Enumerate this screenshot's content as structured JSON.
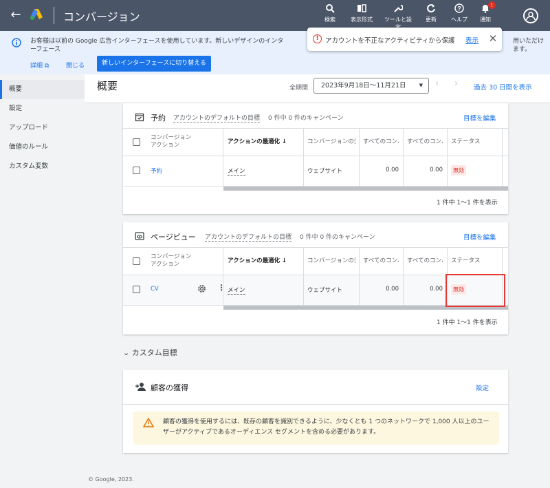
{
  "topbar": {
    "title": "コンバージョン",
    "buttons": [
      {
        "label": "検索",
        "icon": "search-icon"
      },
      {
        "label": "表示形式",
        "icon": "columns-icon"
      },
      {
        "label": "ツールと設定",
        "icon": "wrench-icon"
      },
      {
        "label": "更新",
        "icon": "refresh-icon"
      },
      {
        "label": "ヘルプ",
        "icon": "help-icon"
      },
      {
        "label": "通知",
        "icon": "bell-icon"
      }
    ],
    "notification_badge": "!"
  },
  "banner": {
    "message": "お客様は以前の Google 広告インターフェースを使用しています。新しいデザインのインターフェース",
    "message_tail": "用いただけます。",
    "details_link": "詳細",
    "close_link": "閉じる",
    "switch_button": "新しいインターフェースに切り替える"
  },
  "toast": {
    "text": "アカウントを不正なアクティビティから保護",
    "action": "表示"
  },
  "sidebar": {
    "items": [
      {
        "label": "概要",
        "active": true
      },
      {
        "label": "設定"
      },
      {
        "label": "アップロード"
      },
      {
        "label": "価値のルール"
      },
      {
        "label": "カスタム変数"
      }
    ]
  },
  "header": {
    "title": "概要",
    "period_label": "全期間",
    "date_range": "2023年9月18日〜11月21日",
    "quick_range": "過去 30 日間を表示"
  },
  "table_headers": {
    "action": "コンバージョン\nアクション",
    "optimization": "アクションの最適化",
    "source": "コンバージョンの発",
    "all_conv": "すべてのコンバ",
    "all_conv_value": "すべてのコンバ",
    "status": "ステータス"
  },
  "cards": [
    {
      "name": "予約",
      "goal": "アカウントのデフォルトの目標",
      "campaigns": "0 件中 0 件のキャンペーン",
      "edit": "目標を編集",
      "row": {
        "action": "予約",
        "optimization": "メイン",
        "source": "ウェブサイト",
        "conv": "0.00",
        "value": "0.00",
        "status": "無効"
      },
      "pager": "1 件中 1〜1 件を表示"
    },
    {
      "name": "ページビュー",
      "goal": "アカウントのデフォルトの目標",
      "campaigns": "0 件中 0 件のキャンペーン",
      "edit": "目標を編集",
      "row": {
        "action": "CV",
        "optimization": "メイン",
        "source": "ウェブサイト",
        "conv": "0.00",
        "value": "0.00",
        "status": "無効"
      },
      "pager": "1 件中 1〜1 件を表示"
    }
  ],
  "custom_goals": {
    "label": "カスタム目標"
  },
  "acquisition": {
    "title": "顧客の獲得",
    "settings": "設定",
    "warning": "顧客の獲得を使用するには、既存の顧客を識別できるように、少なくとも 1 つのネットワークで 1,000 人以上のユーザーがアクティブであるオーディエンス セグメントを含める必要があります。"
  },
  "footer": "© Google, 2023.",
  "colors": {
    "topbar": "#4a5568",
    "accent": "#1a73e8",
    "status_red": "#d93025",
    "highlight": "#e53935"
  }
}
